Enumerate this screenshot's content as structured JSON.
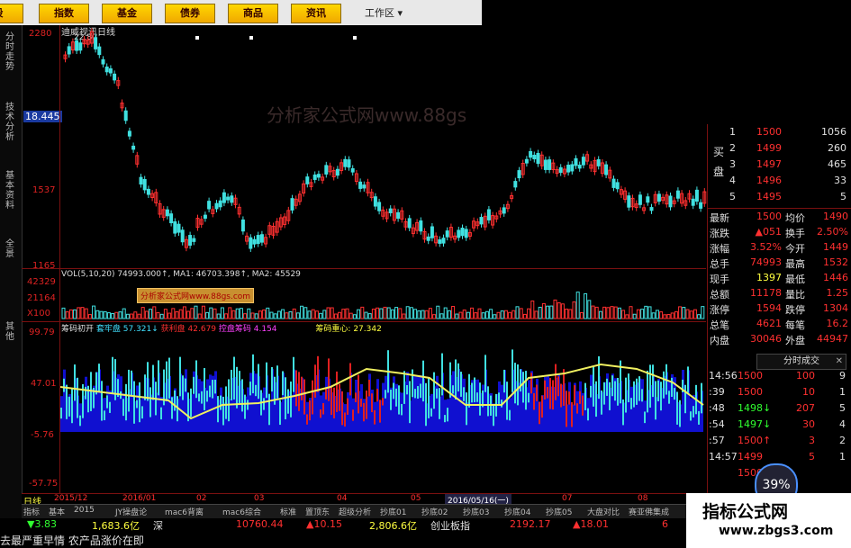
{
  "menu": {
    "items": [
      "股",
      "指数",
      "基金",
      "债券",
      "商品",
      "资讯"
    ],
    "workarea": "工作区"
  },
  "left_tabs": [
    "分时走势",
    "技术分析",
    "基本资料",
    "全景"
  ],
  "left_tabs_bottom": "其他",
  "chart": {
    "title": "迪威视讯日线",
    "price_high_label": "22.80",
    "y_labels": [
      "2280",
      "18.445",
      "1537",
      "1165"
    ],
    "vol_y_labels": [
      "42329",
      "21164",
      "X100"
    ],
    "ind_y_labels": [
      "99.79",
      "47.01",
      "-5.76",
      "-57.75"
    ],
    "vol_legend": "VOL(5,10,20)  74993.000↑, MA1: 46703.398↑, MA2: 45529",
    "ind_legend": [
      "筹码初开",
      "套牢盘 57.321↓",
      "获利盘 42.679",
      "控盘筹码 4.154",
      "筹码重心: 27.342"
    ],
    "watermark1": "分析家公式网www.88gs",
    "watermark2": "分析家公式网www.88gs.com",
    "date_labels": [
      "日线",
      "2015/12",
      "2016/01",
      "02",
      "03",
      "04",
      "05",
      "2016/05/16(一)",
      "07",
      "08"
    ]
  },
  "order_book": {
    "sell": [
      {
        "label": "5",
        "price": "1495",
        "vol": "5"
      },
      {
        "label": "4",
        "price": "1496",
        "vol": "33"
      },
      {
        "label": "3",
        "price": "1497",
        "vol": "465"
      },
      {
        "label": "2",
        "price": "1499",
        "vol": "260"
      },
      {
        "label": "1",
        "price": "1500",
        "vol": "1056"
      }
    ],
    "sell_title": "买盘"
  },
  "stats": [
    {
      "k1": "最新",
      "v1": "1500",
      "k2": "均价",
      "v2": "1490"
    },
    {
      "k1": "涨跌",
      "v1": "▲051",
      "k2": "换手",
      "v2": "2.50%"
    },
    {
      "k1": "涨幅",
      "v1": "3.52%",
      "k2": "今开",
      "v2": "1449"
    },
    {
      "k1": "总手",
      "v1": "74993",
      "k2": "最高",
      "v2": "1532"
    },
    {
      "k1": "现手",
      "v1": "1397",
      "k2": "最低",
      "v2": "1446"
    },
    {
      "k1": "总额",
      "v1": "11178",
      "k2": "量比",
      "v2": "1.25"
    },
    {
      "k1": "涨停",
      "v1": "1594",
      "k2": "跌停",
      "v2": "1304"
    },
    {
      "k1": "总笔",
      "v1": "4621",
      "k2": "每笔",
      "v2": "16.2"
    },
    {
      "k1": "内盘",
      "v1": "30046",
      "k2": "外盘",
      "v2": "44947"
    }
  ],
  "tick_button": "分时成交",
  "ticks": [
    {
      "t": "14:56",
      "p": "1500",
      "v": "100",
      "n": "9"
    },
    {
      "t": ":39",
      "p": "1500",
      "v": "10",
      "n": "1"
    },
    {
      "t": ":48",
      "p": "1498↓",
      "v": "207",
      "n": "5"
    },
    {
      "t": ":54",
      "p": "1497↓",
      "v": "30",
      "n": "4"
    },
    {
      "t": ":57",
      "p": "1500↑",
      "v": "3",
      "n": "2"
    },
    {
      "t": "14:57",
      "p": "1499",
      "v": "5",
      "n": "1"
    },
    {
      "t": "",
      "p": "1500",
      "v": "",
      "n": ""
    }
  ],
  "badge": "39%",
  "bottom_tabs": [
    "指标",
    "基本",
    "2015",
    "JY操盘论",
    "mac6背离",
    "mac6综合",
    "标准",
    "置顶东",
    "超级分析",
    "抄底01",
    "抄底02",
    "抄底03",
    "抄底04",
    "抄底05",
    "大盘对比",
    "赛亚佛集成"
  ],
  "status": {
    "change1": "▼3.83",
    "amount1": "1,683.6亿",
    "mkt1": "深",
    "val2": "10760.44",
    "change2": "▲10.15",
    "amount2": "2,806.6亿",
    "mkt2": "创业板指",
    "val3": "2192.17",
    "change3": "▲18.01",
    "val4": "6",
    "news": "去最严重早情 农产品涨价在即"
  },
  "logo": {
    "line1": "指标公式网",
    "line2": "www.zbgs3.com"
  }
}
